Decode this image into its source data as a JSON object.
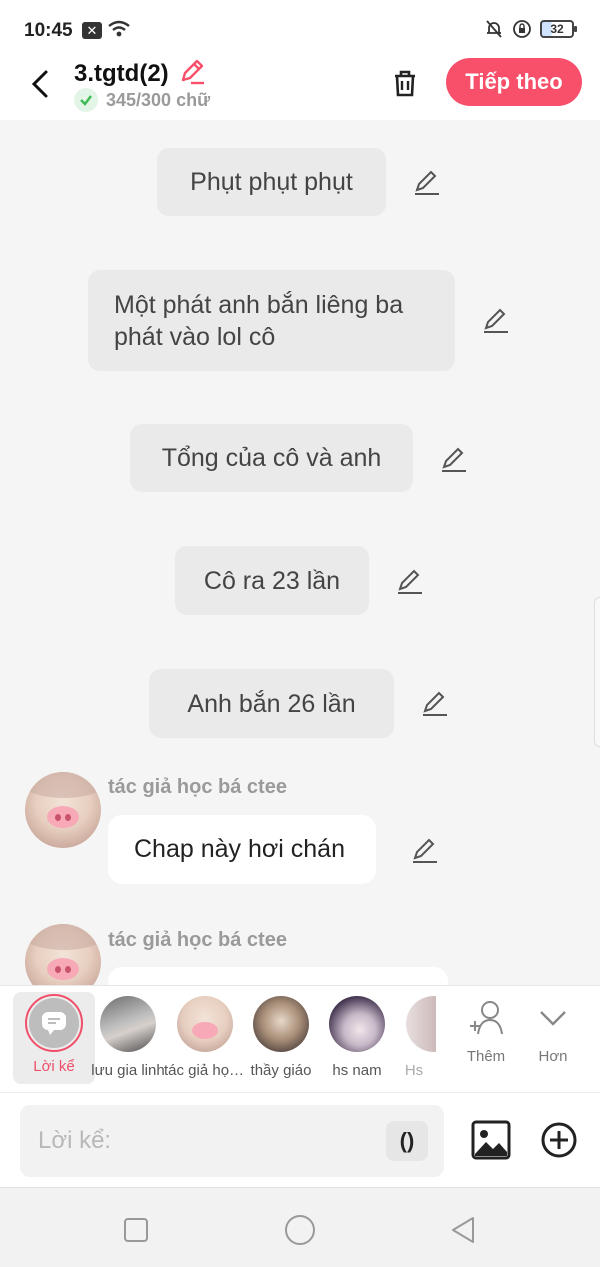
{
  "status_bar": {
    "time": "10:45",
    "battery": "32"
  },
  "header": {
    "title": "3.tgtd(2)",
    "word_count": "345/300 chữ",
    "next_label": "Tiếp theo"
  },
  "messages": [
    {
      "type": "narration",
      "text": "Phụt phụt phụt"
    },
    {
      "type": "narration",
      "text": "Một phát anh bắn liêng ba phát vào lol cô"
    },
    {
      "type": "narration",
      "text": "Tổng của cô và anh"
    },
    {
      "type": "narration",
      "text": "Cô ra 23 lần"
    },
    {
      "type": "narration",
      "text": "Anh bắn 26 lần"
    },
    {
      "type": "dialogue",
      "speaker": "tác giả học bá ctee",
      "text": "Chap này hơi chán"
    },
    {
      "type": "dialogue",
      "speaker": "tác giả học bá ctee",
      "text": ""
    }
  ],
  "characters": [
    {
      "name": "Lời kể",
      "selected": true
    },
    {
      "name": "lưu gia linh"
    },
    {
      "name": "tác giả học bá ctee"
    },
    {
      "name": "thầy giáo"
    },
    {
      "name": "hs nam"
    },
    {
      "name": "Hs"
    }
  ],
  "strip_actions": {
    "add_label": "Thêm",
    "more_label": "Hơn"
  },
  "input": {
    "placeholder": "Lời kể:",
    "paren_label": "()"
  },
  "colors": {
    "accent": "#f8506b",
    "check_green": "#3cba54"
  }
}
